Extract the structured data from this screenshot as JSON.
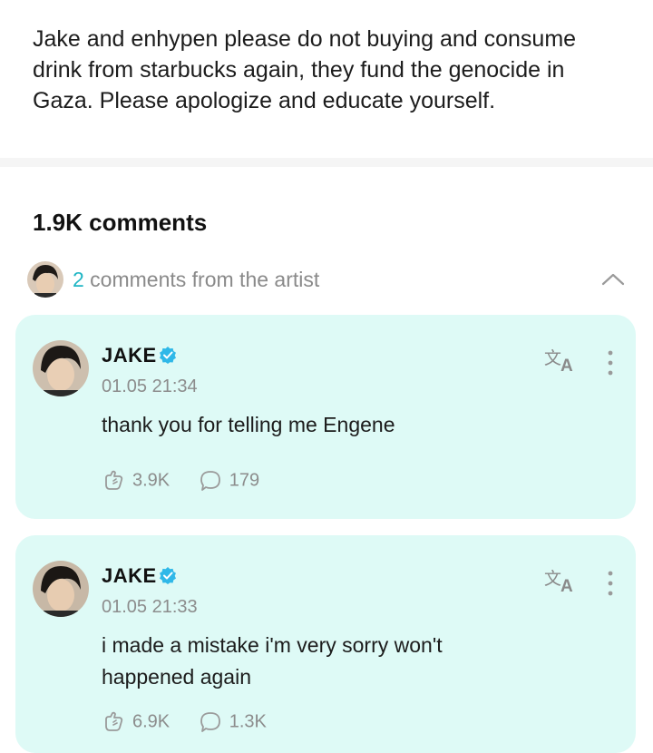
{
  "post": {
    "body": "Jake and enhypen please do not buying and consume drink from starbucks again, they fund the genocide in Gaza. Please apologize and educate yourself."
  },
  "comments_section": {
    "count_label": "1.9K comments",
    "artist_comments": {
      "count": "2",
      "label": " comments from the artist"
    }
  },
  "comments": [
    {
      "author": "JAKE",
      "verified": true,
      "timestamp": "01.05 21:34",
      "text": "thank you for telling me Engene",
      "likes": "3.9K",
      "replies": "179"
    },
    {
      "author": "JAKE",
      "verified": true,
      "timestamp": "01.05 21:33",
      "text": "i made a mistake i'm very sorry won't happened again",
      "likes": "6.9K",
      "replies": "1.3K"
    }
  ],
  "icons": {
    "verified": "verified-badge-icon",
    "translate": "translate-icon",
    "more": "more-vertical-icon",
    "like": "hug-hand-icon",
    "reply": "speech-bubble-icon",
    "collapse": "chevron-up-icon"
  },
  "colors": {
    "card_background": "#defaf6",
    "accent": "#1fb5c4",
    "verified": "#2fb8e8",
    "muted_text": "#8c8c8c"
  }
}
